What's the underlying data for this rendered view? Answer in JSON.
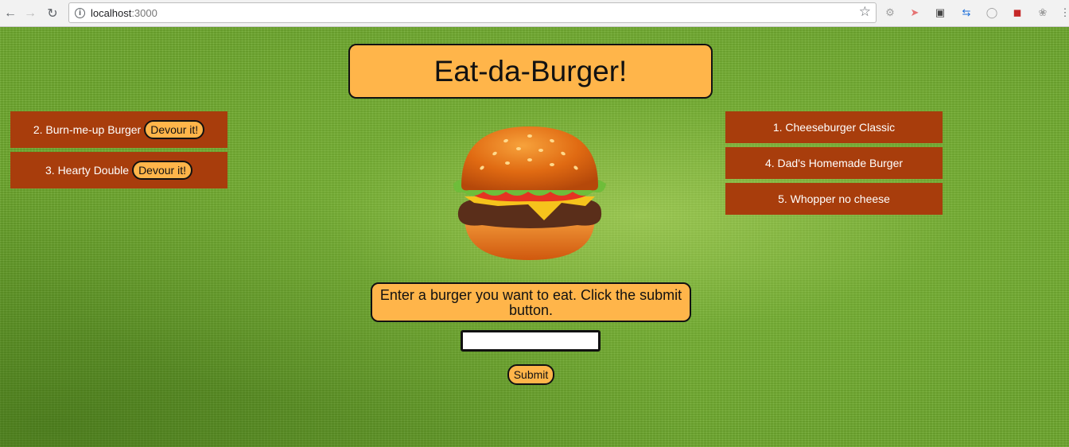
{
  "browser": {
    "url_host": "localhost",
    "url_port": ":3000"
  },
  "page": {
    "title": "Eat-da-Burger!",
    "instruction": "Enter a burger you want to eat. Click the submit button.",
    "input_value": "",
    "submit_label": "Submit",
    "uneaten_burgers": [
      {
        "label": "2. Burn-me-up Burger",
        "action": "Devour it!"
      },
      {
        "label": "3. Hearty Double",
        "action": "Devour it!"
      }
    ],
    "devoured_burgers": [
      {
        "label": "1. Cheeseburger Classic"
      },
      {
        "label": "4. Dad's Homemade Burger"
      },
      {
        "label": "5. Whopper no cheese"
      }
    ]
  },
  "colors": {
    "accent": "#ffb54a",
    "card": "#a83d0c",
    "background": "#6faa2f"
  },
  "icons": [
    "back-icon",
    "forward-icon",
    "reload-icon",
    "info-icon",
    "star-icon",
    "burger-image"
  ]
}
